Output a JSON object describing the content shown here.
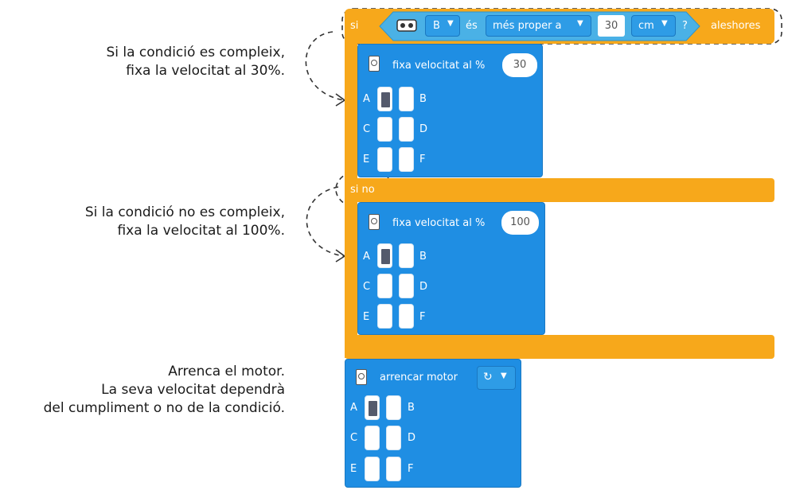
{
  "notes": {
    "note1": [
      "Si la condició es compleix,",
      "fixa la velocitat al 30%."
    ],
    "note2": [
      "Si la condició no es compleix,",
      "fixa la velocitat al 100%."
    ],
    "note3": [
      "Arrenca el motor.",
      "La seva velocitat dependrà",
      "del cumpliment o no de la condició."
    ]
  },
  "if_block": {
    "if_label": "si",
    "sensor_port": "B",
    "is_label": "és",
    "comparison": "més proper a",
    "value": "30",
    "unit": "cm",
    "question": "?",
    "then_label": "aleshores",
    "else_label": "si no"
  },
  "speed_block_1": {
    "label": "fixa velocitat al %",
    "value": "30",
    "ports": [
      "A",
      "B",
      "C",
      "D",
      "E",
      "F"
    ],
    "selected_port": "A"
  },
  "speed_block_2": {
    "label": "fixa velocitat al %",
    "value": "100",
    "ports": [
      "A",
      "B",
      "C",
      "D",
      "E",
      "F"
    ],
    "selected_port": "A"
  },
  "start_block": {
    "label": "arrencar motor",
    "direction_icon": "rotate-clockwise-icon",
    "ports": [
      "A",
      "B",
      "C",
      "D",
      "E",
      "F"
    ],
    "selected_port": "A"
  },
  "colors": {
    "control": "#f7a81b",
    "motor": "#1f8ee3",
    "sensor": "#4ab1e6"
  }
}
